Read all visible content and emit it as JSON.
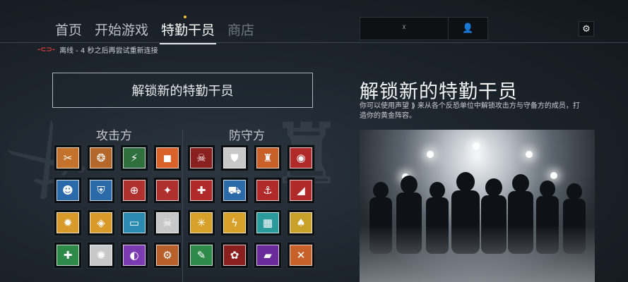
{
  "nav": {
    "tabs": [
      {
        "label": "首页"
      },
      {
        "label": "开始游戏"
      },
      {
        "label": "特勤干员"
      },
      {
        "label": "商店"
      }
    ]
  },
  "topbar": {
    "left_glyph": "ᵡ",
    "right_glyph": "👤",
    "settings_glyph": "⚙"
  },
  "status": {
    "icon": "-⊂⊃-",
    "text": "离线 - 4 秒之后再尝试重新连接"
  },
  "left": {
    "unlock_button": "解锁新的特勤干员",
    "attackers_label": "攻击方",
    "defenders_label": "防守方",
    "attackers": [
      {
        "glyph": "✂",
        "bg": "#c2722a"
      },
      {
        "glyph": "❂",
        "bg": "#b4672a"
      },
      {
        "glyph": "⚡",
        "bg": "#2f6f3e"
      },
      {
        "glyph": "◼",
        "bg": "#d8622a"
      },
      {
        "glyph": "☻",
        "bg": "#2a6aa8"
      },
      {
        "glyph": "⛨",
        "bg": "#2a6aa8"
      },
      {
        "glyph": "⊕",
        "bg": "#b03030"
      },
      {
        "glyph": "✦",
        "bg": "#b03030"
      },
      {
        "glyph": "✹",
        "bg": "#d89a2a"
      },
      {
        "glyph": "◈",
        "bg": "#d89a2a"
      },
      {
        "glyph": "▭",
        "bg": "#2a8ab0"
      },
      {
        "glyph": "☠",
        "bg": "#c8c8c8"
      },
      {
        "glyph": "✚",
        "bg": "#2f8a4a"
      },
      {
        "glyph": "✺",
        "bg": "#c8c8c8"
      },
      {
        "glyph": "◐",
        "bg": "#7a3ab0"
      },
      {
        "glyph": "⚙",
        "bg": "#b8602a"
      }
    ],
    "defenders": [
      {
        "glyph": "☠",
        "bg": "#8a1f1f"
      },
      {
        "glyph": "⛊",
        "bg": "#c8c8c8"
      },
      {
        "glyph": "♜",
        "bg": "#c8602a"
      },
      {
        "glyph": "◉",
        "bg": "#b02a2a"
      },
      {
        "glyph": "✚",
        "bg": "#b02a2a"
      },
      {
        "glyph": "⛟",
        "bg": "#2a6aa8"
      },
      {
        "glyph": "⚓",
        "bg": "#b02a2a"
      },
      {
        "glyph": "◢",
        "bg": "#b02a2a"
      },
      {
        "glyph": "✳",
        "bg": "#d8a22a"
      },
      {
        "glyph": "ϟ",
        "bg": "#d8a22a"
      },
      {
        "glyph": "▦",
        "bg": "#2a9a9a"
      },
      {
        "glyph": "♠",
        "bg": "#c8a02a"
      },
      {
        "glyph": "✎",
        "bg": "#2f8a4a"
      },
      {
        "glyph": "✿",
        "bg": "#8a1f1f"
      },
      {
        "glyph": "▰",
        "bg": "#6a2a9a"
      },
      {
        "glyph": "✕",
        "bg": "#c8602a"
      }
    ]
  },
  "right": {
    "title": "解锁新的特勤干员",
    "desc_part1": "你可以使用声望",
    "desc_icon": "⟫",
    "desc_part2": "来从各个反恐单位中解锁攻击方与守备方的成员，打造你的黄金阵容。"
  },
  "colors": {
    "accent_status": "#e53b3b",
    "nav_dot": "#f0c040"
  }
}
